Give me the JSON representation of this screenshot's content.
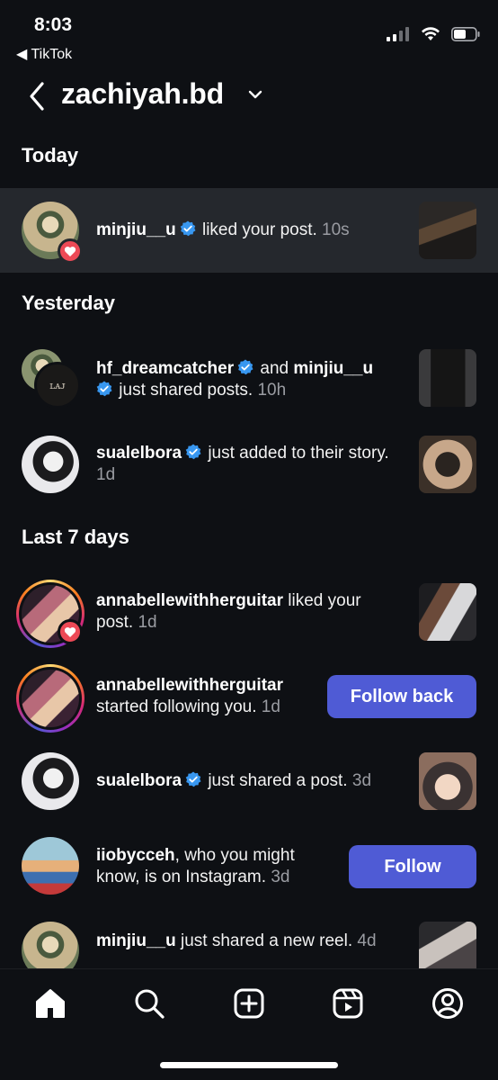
{
  "status_bar": {
    "time": "8:03",
    "back_app": "◀ TikTok"
  },
  "header": {
    "account_name": "zachiyah.bd"
  },
  "sections": {
    "today": "Today",
    "yesterday": "Yesterday",
    "last7": "Last 7 days"
  },
  "notifications": {
    "n1": {
      "user": "minjiu__u",
      "action": "liked your post.",
      "time": "10s"
    },
    "n2": {
      "user1": "hf_dreamcatcher",
      "joiner": "and",
      "user2": "minjiu__u",
      "action": "just shared posts.",
      "time": "10h"
    },
    "n3": {
      "user": "sualelbora",
      "action": "just added to their story.",
      "time": "1d"
    },
    "n4": {
      "user": "annabellewithherguitar",
      "action": "liked your post.",
      "time": "1d"
    },
    "n5": {
      "user": "annabellewithherguitar",
      "action": "started following you.",
      "time": "1d",
      "button": "Follow back"
    },
    "n6": {
      "user": "sualelbora",
      "action": "just shared a post.",
      "time": "3d"
    },
    "n7": {
      "user": "iiobycceh",
      "action": ", who you might know, is on Instagram.",
      "time": "3d",
      "button": "Follow"
    },
    "n8": {
      "user": "minjiu__u",
      "action": "just shared a new reel.",
      "time": "4d"
    }
  },
  "bottom_nav": {
    "items": [
      "home-icon",
      "search-icon",
      "create-icon",
      "reels-icon",
      "profile-icon"
    ]
  },
  "colors": {
    "background": "#0e1014",
    "highlight": "#25282d",
    "accent": "#4f5bd5",
    "verified": "#3897f0",
    "like": "#ed4956",
    "muted": "#9a9ca2"
  }
}
